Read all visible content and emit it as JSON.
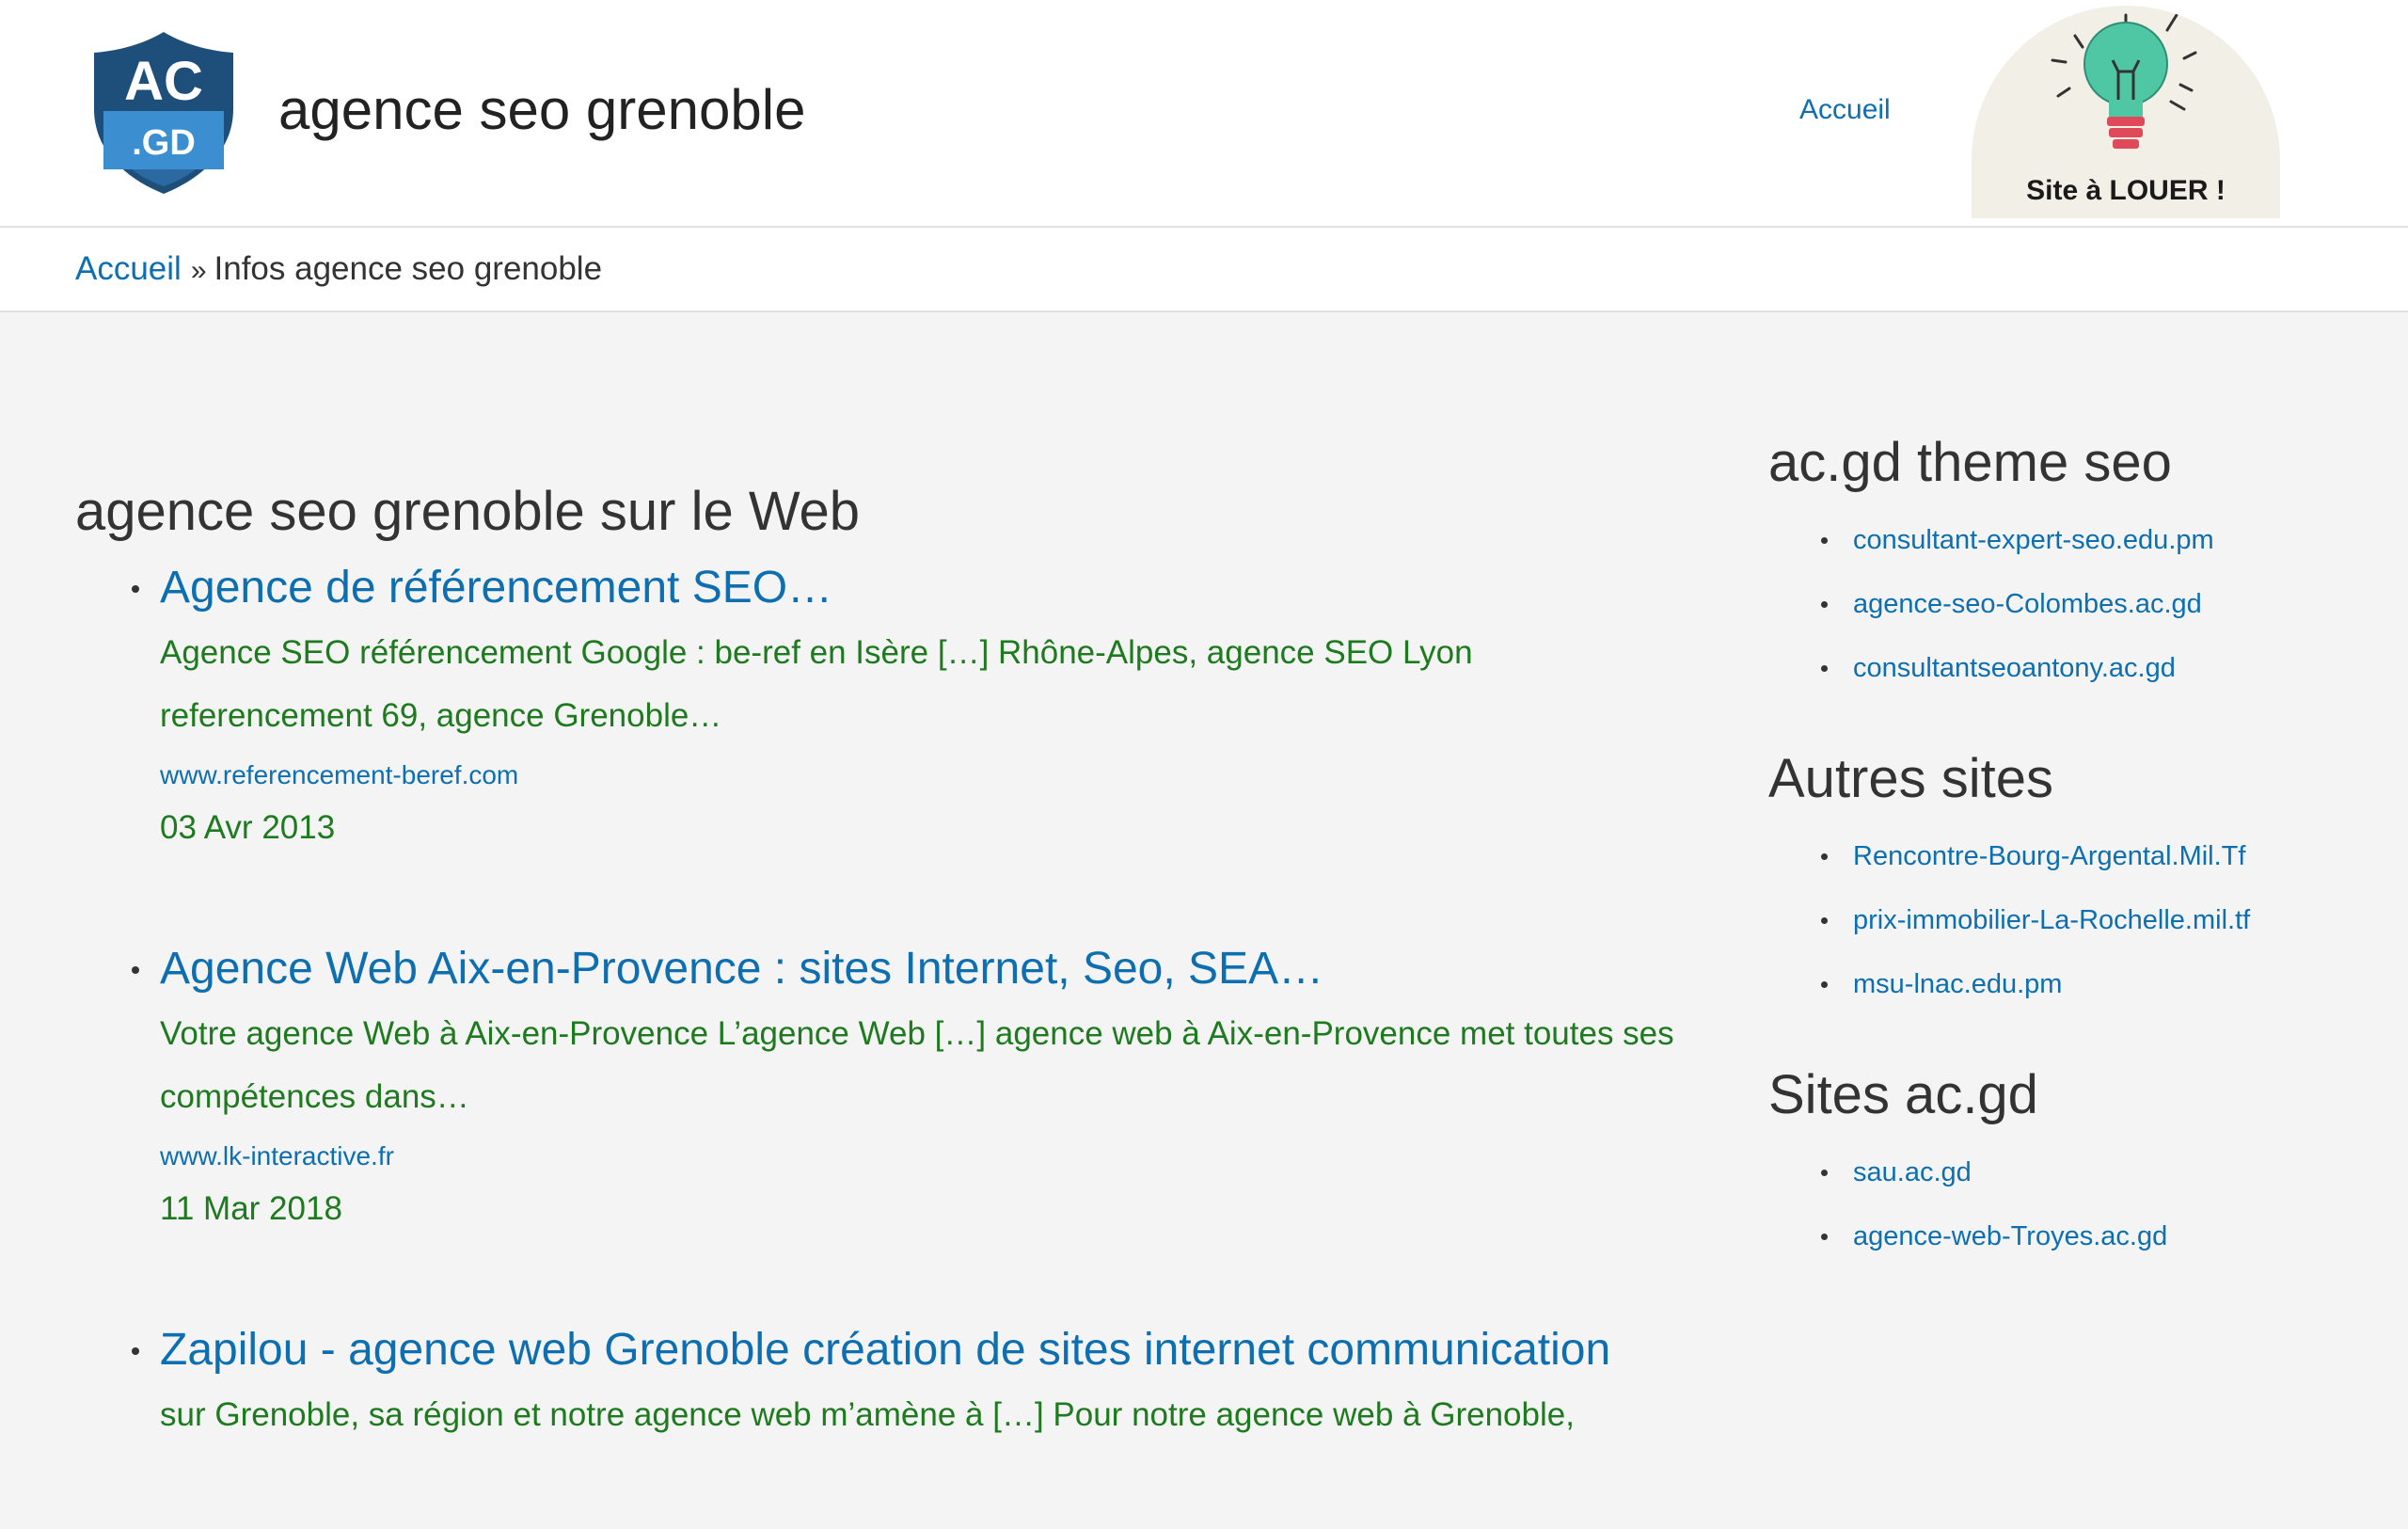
{
  "header": {
    "site_title": "agence seo grenoble",
    "nav": {
      "home_label": "Accueil"
    },
    "logo": {
      "top_text": "AC",
      "bottom_text": ".GD",
      "colors": {
        "shield": "#1e4f7a",
        "ribbon": "#3b8fd1"
      }
    },
    "promo": {
      "text": "Site à LOUER !",
      "icon": "lightbulb-icon"
    }
  },
  "breadcrumb": {
    "home_label": "Accueil",
    "separator": "»",
    "current": "Infos agence seo grenoble"
  },
  "main": {
    "heading": "agence seo grenoble sur le Web",
    "results": [
      {
        "title": "Agence de référencement SEO…",
        "snippet": "Agence SEO référencement Google : be-ref en Isère […] Rhône-Alpes, agence SEO Lyon referencement 69, agence Grenoble…",
        "url": "www.referencement-beref.com",
        "date": "03 Avr 2013"
      },
      {
        "title": "Agence Web Aix-en-Provence : sites Internet, Seo, SEA…",
        "snippet": "Votre agence Web à Aix-en-Provence L’agence Web […] agence web à Aix-en-Provence met toutes ses compétences dans…",
        "url": "www.lk-interactive.fr",
        "date": "11 Mar 2018"
      },
      {
        "title": "Zapilou - agence web Grenoble création de sites internet communication",
        "snippet": "sur Grenoble, sa région et notre agence web m’amène à […] Pour notre agence web à Grenoble,"
      }
    ]
  },
  "sidebar": {
    "sections": [
      {
        "heading": "ac.gd theme seo",
        "links": [
          "consultant-expert-seo.edu.pm",
          "agence-seo-Colombes.ac.gd",
          "consultantseoantony.ac.gd"
        ]
      },
      {
        "heading": "Autres sites",
        "links": [
          "Rencontre-Bourg-Argental.Mil.Tf",
          "prix-immobilier-La-Rochelle.mil.tf",
          "msu-lnac.edu.pm"
        ]
      },
      {
        "heading": "Sites ac.gd",
        "links": [
          "sau.ac.gd",
          "agence-web-Troyes.ac.gd"
        ]
      }
    ]
  },
  "colors": {
    "link": "#0e6fb0",
    "snippet": "#1e7a1e",
    "background": "#f4f4f4"
  }
}
